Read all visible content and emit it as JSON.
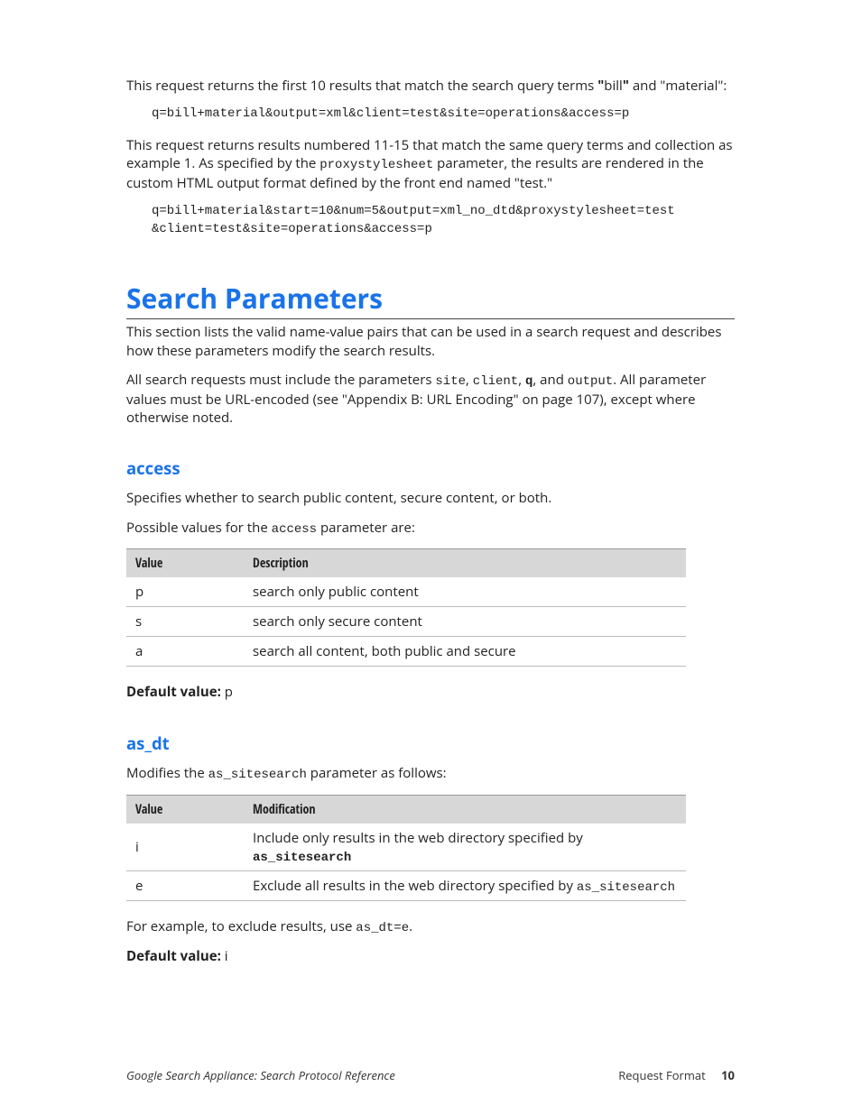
{
  "intro": {
    "p1_a": "This request returns the first 10 results that match the search query terms ",
    "p1_b": "bill",
    "p1_c": " and \"material\":",
    "code1": "q=bill+material&output=xml&client=test&site=operations&access=p",
    "p2_a": "This request returns results numbered 11-15 that match the same query terms and collection as example 1. As specified by the ",
    "p2_code": "proxystylesheet",
    "p2_b": " parameter, the results are rendered in the custom HTML output format defined by the front end named \"test.\"",
    "code2": "q=bill+material&start=10&num=5&output=xml_no_dtd&proxystylesheet=test\n&client=test&site=operations&access=p"
  },
  "searchParams": {
    "title": "Search Parameters",
    "p1": "This section lists the valid name-value pairs that can be used in a search request and describes how these parameters modify the search results.",
    "p2_a": "All search requests must include the parameters ",
    "p2_site": "site",
    "p2_client": "client",
    "p2_q": "q",
    "p2_output": "output",
    "p2_b": ". All parameter values must be URL-encoded (see \"Appendix B: URL Encoding\" on page 107), except where otherwise noted."
  },
  "access": {
    "title": "access",
    "desc": "Specifies whether to search public content, secure content, or both.",
    "lead_a": "Possible values for the ",
    "lead_code": "access",
    "lead_b": " parameter are:",
    "th_value": "Value",
    "th_desc": "Description",
    "rows": {
      "r0": {
        "v": "p",
        "d": "search only public content"
      },
      "r1": {
        "v": "s",
        "d": "search only secure content"
      },
      "r2": {
        "v": "a",
        "d": "search all content, both public and secure"
      }
    },
    "default_label": "Default value:",
    "default_value": " p"
  },
  "as_dt": {
    "title": "as_dt",
    "desc_a": "Modifies the ",
    "desc_code": "as_sitesearch",
    "desc_b": " parameter as follows:",
    "th_value": "Value",
    "th_mod": "Modification",
    "rows": {
      "r0": {
        "v": "i",
        "d_a": "Include only results in the web directory specified by ",
        "d_code": "as_sitesearch"
      },
      "r1": {
        "v": "e",
        "d_a": "Exclude all results in the web directory specified by ",
        "d_code": "as_sitesearch"
      }
    },
    "example_a": "For example, to exclude results, use ",
    "example_code": "as_dt=e",
    "example_b": ".",
    "default_label": "Default value:",
    "default_value": " i"
  },
  "footer": {
    "left": "Google Search Appliance: Search Protocol Reference",
    "right_label": "Request Format",
    "page_number": "10"
  }
}
